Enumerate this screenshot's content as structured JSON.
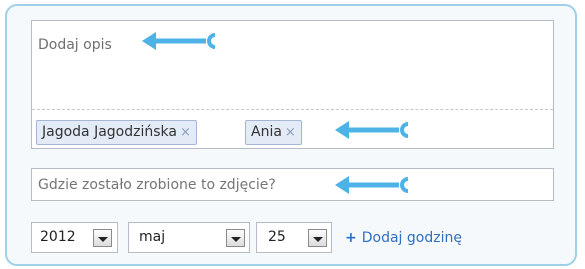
{
  "description": {
    "placeholder": "Dodaj opis"
  },
  "tags": [
    {
      "label": "Jagoda Jagodzińska",
      "remove": "×"
    },
    {
      "label": "Ania",
      "remove": "×"
    }
  ],
  "location": {
    "placeholder": "Gdzie zostało zrobione to zdjęcie?"
  },
  "date": {
    "year": "2012",
    "month": "maj",
    "day": "25"
  },
  "add_hour": {
    "plus": "+",
    "label": "Dodaj godzinę"
  },
  "colors": {
    "accent": "#4db3e6",
    "link": "#2f6fc0",
    "tag_bg": "#e2ebf6",
    "frame_border": "#9fd0e8"
  },
  "icons": [
    "arrow-left-icon",
    "remove-tag-icon",
    "dropdown-arrow-icon",
    "plus-icon"
  ]
}
